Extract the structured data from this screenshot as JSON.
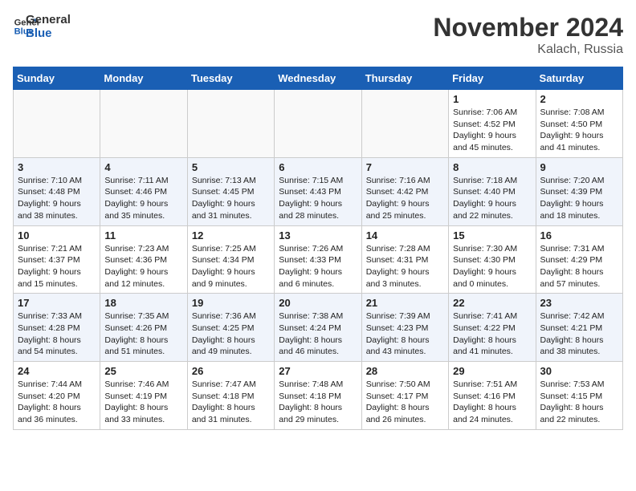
{
  "logo": {
    "line1": "General",
    "line2": "Blue"
  },
  "header": {
    "month_year": "November 2024",
    "location": "Kalach, Russia"
  },
  "days_of_week": [
    "Sunday",
    "Monday",
    "Tuesday",
    "Wednesday",
    "Thursday",
    "Friday",
    "Saturday"
  ],
  "weeks": [
    [
      {
        "day": "",
        "info": ""
      },
      {
        "day": "",
        "info": ""
      },
      {
        "day": "",
        "info": ""
      },
      {
        "day": "",
        "info": ""
      },
      {
        "day": "",
        "info": ""
      },
      {
        "day": "1",
        "info": "Sunrise: 7:06 AM\nSunset: 4:52 PM\nDaylight: 9 hours\nand 45 minutes."
      },
      {
        "day": "2",
        "info": "Sunrise: 7:08 AM\nSunset: 4:50 PM\nDaylight: 9 hours\nand 41 minutes."
      }
    ],
    [
      {
        "day": "3",
        "info": "Sunrise: 7:10 AM\nSunset: 4:48 PM\nDaylight: 9 hours\nand 38 minutes."
      },
      {
        "day": "4",
        "info": "Sunrise: 7:11 AM\nSunset: 4:46 PM\nDaylight: 9 hours\nand 35 minutes."
      },
      {
        "day": "5",
        "info": "Sunrise: 7:13 AM\nSunset: 4:45 PM\nDaylight: 9 hours\nand 31 minutes."
      },
      {
        "day": "6",
        "info": "Sunrise: 7:15 AM\nSunset: 4:43 PM\nDaylight: 9 hours\nand 28 minutes."
      },
      {
        "day": "7",
        "info": "Sunrise: 7:16 AM\nSunset: 4:42 PM\nDaylight: 9 hours\nand 25 minutes."
      },
      {
        "day": "8",
        "info": "Sunrise: 7:18 AM\nSunset: 4:40 PM\nDaylight: 9 hours\nand 22 minutes."
      },
      {
        "day": "9",
        "info": "Sunrise: 7:20 AM\nSunset: 4:39 PM\nDaylight: 9 hours\nand 18 minutes."
      }
    ],
    [
      {
        "day": "10",
        "info": "Sunrise: 7:21 AM\nSunset: 4:37 PM\nDaylight: 9 hours\nand 15 minutes."
      },
      {
        "day": "11",
        "info": "Sunrise: 7:23 AM\nSunset: 4:36 PM\nDaylight: 9 hours\nand 12 minutes."
      },
      {
        "day": "12",
        "info": "Sunrise: 7:25 AM\nSunset: 4:34 PM\nDaylight: 9 hours\nand 9 minutes."
      },
      {
        "day": "13",
        "info": "Sunrise: 7:26 AM\nSunset: 4:33 PM\nDaylight: 9 hours\nand 6 minutes."
      },
      {
        "day": "14",
        "info": "Sunrise: 7:28 AM\nSunset: 4:31 PM\nDaylight: 9 hours\nand 3 minutes."
      },
      {
        "day": "15",
        "info": "Sunrise: 7:30 AM\nSunset: 4:30 PM\nDaylight: 9 hours\nand 0 minutes."
      },
      {
        "day": "16",
        "info": "Sunrise: 7:31 AM\nSunset: 4:29 PM\nDaylight: 8 hours\nand 57 minutes."
      }
    ],
    [
      {
        "day": "17",
        "info": "Sunrise: 7:33 AM\nSunset: 4:28 PM\nDaylight: 8 hours\nand 54 minutes."
      },
      {
        "day": "18",
        "info": "Sunrise: 7:35 AM\nSunset: 4:26 PM\nDaylight: 8 hours\nand 51 minutes."
      },
      {
        "day": "19",
        "info": "Sunrise: 7:36 AM\nSunset: 4:25 PM\nDaylight: 8 hours\nand 49 minutes."
      },
      {
        "day": "20",
        "info": "Sunrise: 7:38 AM\nSunset: 4:24 PM\nDaylight: 8 hours\nand 46 minutes."
      },
      {
        "day": "21",
        "info": "Sunrise: 7:39 AM\nSunset: 4:23 PM\nDaylight: 8 hours\nand 43 minutes."
      },
      {
        "day": "22",
        "info": "Sunrise: 7:41 AM\nSunset: 4:22 PM\nDaylight: 8 hours\nand 41 minutes."
      },
      {
        "day": "23",
        "info": "Sunrise: 7:42 AM\nSunset: 4:21 PM\nDaylight: 8 hours\nand 38 minutes."
      }
    ],
    [
      {
        "day": "24",
        "info": "Sunrise: 7:44 AM\nSunset: 4:20 PM\nDaylight: 8 hours\nand 36 minutes."
      },
      {
        "day": "25",
        "info": "Sunrise: 7:46 AM\nSunset: 4:19 PM\nDaylight: 8 hours\nand 33 minutes."
      },
      {
        "day": "26",
        "info": "Sunrise: 7:47 AM\nSunset: 4:18 PM\nDaylight: 8 hours\nand 31 minutes."
      },
      {
        "day": "27",
        "info": "Sunrise: 7:48 AM\nSunset: 4:18 PM\nDaylight: 8 hours\nand 29 minutes."
      },
      {
        "day": "28",
        "info": "Sunrise: 7:50 AM\nSunset: 4:17 PM\nDaylight: 8 hours\nand 26 minutes."
      },
      {
        "day": "29",
        "info": "Sunrise: 7:51 AM\nSunset: 4:16 PM\nDaylight: 8 hours\nand 24 minutes."
      },
      {
        "day": "30",
        "info": "Sunrise: 7:53 AM\nSunset: 4:15 PM\nDaylight: 8 hours\nand 22 minutes."
      }
    ]
  ]
}
